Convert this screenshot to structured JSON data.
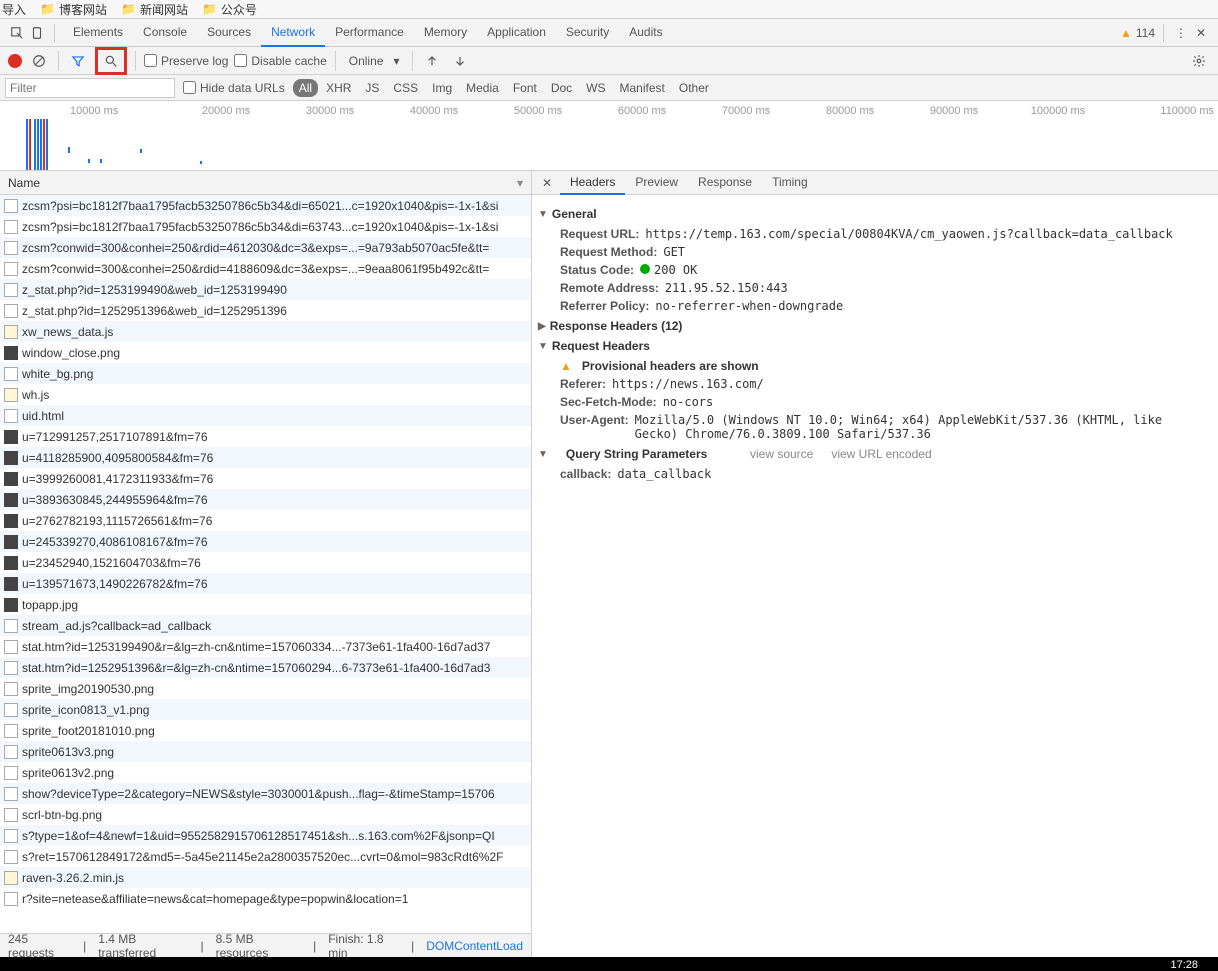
{
  "bookmarks": [
    {
      "label": "导入"
    },
    {
      "label": "博客网站"
    },
    {
      "label": "新闻网站"
    },
    {
      "label": "公众号"
    }
  ],
  "tabs": [
    "Elements",
    "Console",
    "Sources",
    "Network",
    "Performance",
    "Memory",
    "Application",
    "Security",
    "Audits"
  ],
  "active_tab": "Network",
  "warning_count": "114",
  "toolbar": {
    "preserve": "Preserve log",
    "disable": "Disable cache",
    "online": "Online"
  },
  "filter": {
    "placeholder": "Filter",
    "hide_urls": "Hide data URLs",
    "pills": [
      "All",
      "XHR",
      "JS",
      "CSS",
      "Img",
      "Media",
      "Font",
      "Doc",
      "WS",
      "Manifest",
      "Other"
    ]
  },
  "timeline_labels": [
    "10000 ms",
    "20000 ms",
    "30000 ms",
    "40000 ms",
    "50000 ms",
    "60000 ms",
    "70000 ms",
    "80000 ms",
    "90000 ms",
    "100000 ms",
    "110000 ms"
  ],
  "name_header": "Name",
  "requests": [
    {
      "t": "doc",
      "n": "zcsm?psi=bc1812f7baa1795facb53250786c5b34&di=65021...c=1920x1040&pis=-1x-1&si"
    },
    {
      "t": "doc",
      "n": "zcsm?psi=bc1812f7baa1795facb53250786c5b34&di=63743...c=1920x1040&pis=-1x-1&si"
    },
    {
      "t": "doc",
      "n": "zcsm?conwid=300&conhei=250&rdid=4612030&dc=3&exps=...=9a793ab5070ac5fe&tt="
    },
    {
      "t": "doc",
      "n": "zcsm?conwid=300&conhei=250&rdid=4188609&dc=3&exps=...=9eaa8061f95b492c&tt="
    },
    {
      "t": "doc",
      "n": "z_stat.php?id=1253199490&web_id=1253199490"
    },
    {
      "t": "doc",
      "n": "z_stat.php?id=1252951396&web_id=1252951396"
    },
    {
      "t": "js",
      "n": "xw_news_data.js"
    },
    {
      "t": "img",
      "n": "window_close.png"
    },
    {
      "t": "doc",
      "n": "white_bg.png"
    },
    {
      "t": "js",
      "n": "wh.js"
    },
    {
      "t": "doc",
      "n": "uid.html"
    },
    {
      "t": "img",
      "n": "u=712991257,2517107891&fm=76"
    },
    {
      "t": "img",
      "n": "u=4118285900,4095800584&fm=76"
    },
    {
      "t": "img",
      "n": "u=3999260081,4172311933&fm=76"
    },
    {
      "t": "img",
      "n": "u=3893630845,244955964&fm=76"
    },
    {
      "t": "img",
      "n": "u=2762782193,1115726561&fm=76"
    },
    {
      "t": "img",
      "n": "u=245339270,4086108167&fm=76"
    },
    {
      "t": "img",
      "n": "u=23452940,1521604703&fm=76"
    },
    {
      "t": "img",
      "n": "u=139571673,1490226782&fm=76"
    },
    {
      "t": "img",
      "n": "topapp.jpg"
    },
    {
      "t": "doc",
      "n": "stream_ad.js?callback=ad_callback"
    },
    {
      "t": "doc",
      "n": "stat.htm?id=1253199490&r=&lg=zh-cn&ntime=157060334...-7373e61-1fa400-16d7ad37"
    },
    {
      "t": "doc",
      "n": "stat.htm?id=1252951396&r=&lg=zh-cn&ntime=157060294...6-7373e61-1fa400-16d7ad3"
    },
    {
      "t": "doc",
      "n": "sprite_img20190530.png"
    },
    {
      "t": "doc",
      "n": "sprite_icon0813_v1.png"
    },
    {
      "t": "doc",
      "n": "sprite_foot20181010.png"
    },
    {
      "t": "doc",
      "n": "sprite0613v3.png"
    },
    {
      "t": "doc",
      "n": "sprite0613v2.png"
    },
    {
      "t": "doc",
      "n": "show?deviceType=2&category=NEWS&style=3030001&push...flag=-&timeStamp=15706"
    },
    {
      "t": "doc",
      "n": "scrl-btn-bg.png"
    },
    {
      "t": "doc",
      "n": "s?type=1&of=4&newf=1&uid=9552582915706128517451&sh...s.163.com%2F&jsonp=QI"
    },
    {
      "t": "doc",
      "n": "s?ret=1570612849172&md5=-5a45e21145e2a2800357520ec...cvrt=0&mol=983cRdt6%2F"
    },
    {
      "t": "js",
      "n": "raven-3.26.2.min.js"
    },
    {
      "t": "doc",
      "n": "r?site=netease&affiliate=news&cat=homepage&type=popwin&location=1"
    }
  ],
  "status": {
    "requests": "245 requests",
    "transferred": "1.4 MB transferred",
    "resources": "8.5 MB resources",
    "finish": "Finish: 1.8 min",
    "dom": "DOMContentLoad"
  },
  "detail_tabs": [
    "Headers",
    "Preview",
    "Response",
    "Timing"
  ],
  "detail": {
    "general": "General",
    "url_k": "Request URL:",
    "url_v": "https://temp.163.com/special/00804KVA/cm_yaowen.js?callback=data_callback",
    "method_k": "Request Method:",
    "method_v": "GET",
    "status_k": "Status Code:",
    "status_v": "200 OK",
    "remote_k": "Remote Address:",
    "remote_v": "211.95.52.150:443",
    "refpol_k": "Referrer Policy:",
    "refpol_v": "no-referrer-when-downgrade",
    "resp_hdr": "Response Headers (12)",
    "req_hdr": "Request Headers",
    "prov": "Provisional headers are shown",
    "ref_k": "Referer:",
    "ref_v": "https://news.163.com/",
    "sfm_k": "Sec-Fetch-Mode:",
    "sfm_v": "no-cors",
    "ua_k": "User-Agent:",
    "ua_v": "Mozilla/5.0 (Windows NT 10.0; Win64; x64) AppleWebKit/537.36 (KHTML, like Gecko) Chrome/76.0.3809.100 Safari/537.36",
    "qsp": "Query String Parameters",
    "qsp_vs": "view source",
    "qsp_vu": "view URL encoded",
    "cb_k": "callback:",
    "cb_v": "data_callback"
  },
  "clock": "17:28"
}
